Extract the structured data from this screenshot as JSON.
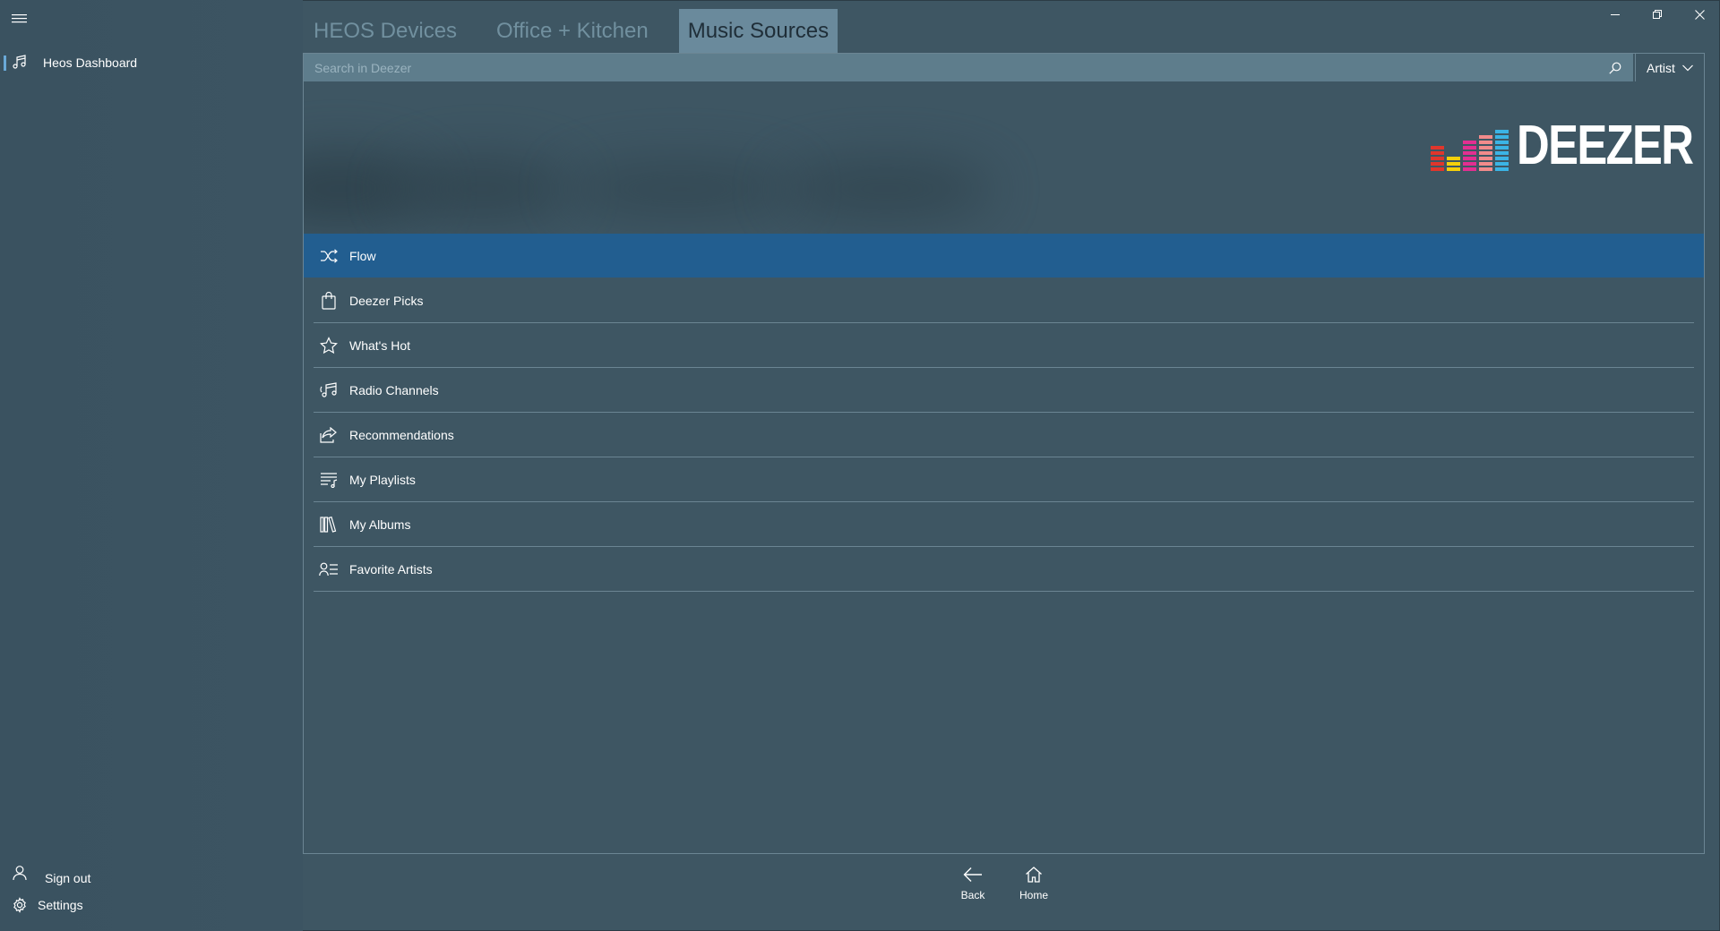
{
  "nav": {
    "items": [
      {
        "label": "Heos Dashboard",
        "icon": "music-note-icon"
      }
    ],
    "footer": [
      {
        "label": "Sign out",
        "icon": "person-icon"
      },
      {
        "label": "Settings",
        "icon": "gear-icon"
      }
    ]
  },
  "tabs": [
    {
      "label": "HEOS Devices",
      "active": false
    },
    {
      "label": "Office + Kitchen",
      "active": false
    },
    {
      "label": "Music Sources",
      "active": true
    }
  ],
  "search": {
    "placeholder": "Search in Deezer",
    "value": "",
    "filter": "Artist"
  },
  "banner": {
    "logo_text": "DEEZER",
    "logo_colors": [
      "#e0362c",
      "#f5d00a",
      "#e22f91",
      "#f28b8b",
      "#3bb4e5"
    ]
  },
  "menu": {
    "items": [
      {
        "label": "Flow",
        "icon": "shuffle-icon",
        "selected": true
      },
      {
        "label": "Deezer Picks",
        "icon": "shopping-bag-icon",
        "selected": false
      },
      {
        "label": "What's Hot",
        "icon": "star-icon",
        "selected": false
      },
      {
        "label": "Radio Channels",
        "icon": "radio-music-icon",
        "selected": false
      },
      {
        "label": "Recommendations",
        "icon": "share-icon",
        "selected": false
      },
      {
        "label": "My Playlists",
        "icon": "playlist-icon",
        "selected": false
      },
      {
        "label": "My Albums",
        "icon": "library-icon",
        "selected": false
      },
      {
        "label": "Favorite Artists",
        "icon": "contact-list-icon",
        "selected": false
      }
    ]
  },
  "commands": {
    "back": "Back",
    "home": "Home"
  },
  "colors": {
    "background": "#3e5663",
    "accent": "#225e90",
    "tab_active_bg": "#6a8a9c",
    "search_bg": "#5e7d8c"
  }
}
